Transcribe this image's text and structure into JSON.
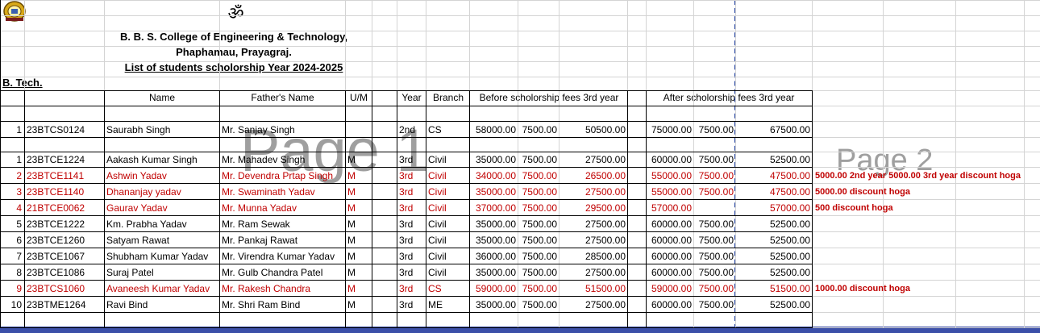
{
  "om_symbol": "ॐ",
  "college_line1": "B. B. S. College of Engineering & Technology,",
  "college_line2": "Phaphamau, Prayagraj.",
  "list_title": "List of students scholorship Year 2024-2025",
  "program": "B. Tech.",
  "headers": {
    "name": "Name",
    "father": "Father's Name",
    "um": "U/M",
    "year": "Year",
    "branch": "Branch",
    "before": "Before scholorship fees 3rd year",
    "after": "After scholorship fees 3rd year"
  },
  "watermarks": {
    "page1": "Page 1",
    "page2": "Page 2"
  },
  "first_row": {
    "sno": "1",
    "roll": "23BTCS0124",
    "name": "Saurabh Singh",
    "father": "Mr. Sanjay Singh",
    "um": "",
    "year": "2nd",
    "branch": "CS",
    "b1": "58000.00",
    "b2": "7500.00",
    "b3": "50500.00",
    "a1": "75000.00",
    "a2": "7500.00",
    "a3": "67500.00"
  },
  "rows": [
    {
      "sno": "1",
      "roll": "23BTCE1224",
      "name": "Aakash Kumar Singh",
      "father": "Mr. Mahadev Singh",
      "um": "M",
      "year": "3rd",
      "branch": "Civil",
      "b1": "35000.00",
      "b2": "7500.00",
      "b3": "27500.00",
      "a1": "60000.00",
      "a2": "7500.00",
      "a3": "52500.00",
      "note": "",
      "red": false
    },
    {
      "sno": "2",
      "roll": "23BTCE1141",
      "name": "Ashwin Yadav",
      "father": "Mr. Devendra Prtap Singh",
      "um": "M",
      "year": "3rd",
      "branch": "Civil",
      "b1": "34000.00",
      "b2": "7500.00",
      "b3": "26500.00",
      "a1": "55000.00",
      "a2": "7500.00",
      "a3": "47500.00",
      "note": "5000.00 2nd year 5000.00 3rd year discount hoga",
      "red": true
    },
    {
      "sno": "3",
      "roll": "23BTCE1140",
      "name": "Dhananjay yadav",
      "father": "Mr. Swaminath Yadav",
      "um": "M",
      "year": "3rd",
      "branch": "Civil",
      "b1": "35000.00",
      "b2": "7500.00",
      "b3": "27500.00",
      "a1": "55000.00",
      "a2": "7500.00",
      "a3": "47500.00",
      "note": "5000.00 discount hoga",
      "red": true
    },
    {
      "sno": "4",
      "roll": "21BTCE0062",
      "name": "Gaurav Yadav",
      "father": "Mr. Munna Yadav",
      "um": "M",
      "year": "3rd",
      "branch": "Civil",
      "b1": "37000.00",
      "b2": "7500.00",
      "b3": "29500.00",
      "a1": "57000.00",
      "a2": "",
      "a3": "57000.00",
      "note": "500 discount hoga",
      "red": true
    },
    {
      "sno": "5",
      "roll": "23BTCE1222",
      "name": "Km. Prabha Yadav",
      "father": "Mr. Ram Sewak",
      "um": "M",
      "year": "3rd",
      "branch": "Civil",
      "b1": "35000.00",
      "b2": "7500.00",
      "b3": "27500.00",
      "a1": "60000.00",
      "a2": "7500.00",
      "a3": "52500.00",
      "note": "",
      "red": false
    },
    {
      "sno": "6",
      "roll": "23BTCE1260",
      "name": "Satyam Rawat",
      "father": "Mr. Pankaj Rawat",
      "um": "M",
      "year": "3rd",
      "branch": "Civil",
      "b1": "35000.00",
      "b2": "7500.00",
      "b3": "27500.00",
      "a1": "60000.00",
      "a2": "7500.00",
      "a3": "52500.00",
      "note": "",
      "red": false
    },
    {
      "sno": "7",
      "roll": "23BTCE1067",
      "name": "Shubham Kumar Yadav",
      "father": "Mr. Virendra Kumar Yadav",
      "um": "M",
      "year": "3rd",
      "branch": "Civil",
      "b1": "36000.00",
      "b2": "7500.00",
      "b3": "28500.00",
      "a1": "60000.00",
      "a2": "7500.00",
      "a3": "52500.00",
      "note": "",
      "red": false
    },
    {
      "sno": "8",
      "roll": "23BTCE1086",
      "name": "Suraj Patel",
      "father": "Mr. Gulb Chandra Patel",
      "um": "M",
      "year": "3rd",
      "branch": "Civil",
      "b1": "35000.00",
      "b2": "7500.00",
      "b3": "27500.00",
      "a1": "60000.00",
      "a2": "7500.00",
      "a3": "52500.00",
      "note": "",
      "red": false
    },
    {
      "sno": "9",
      "roll": "23BTCS1060",
      "name": "Avaneesh Kumar Yadav",
      "father": "Mr. Rakesh Chandra",
      "um": "M",
      "year": "3rd",
      "branch": "CS",
      "b1": "59000.00",
      "b2": "7500.00",
      "b3": "51500.00",
      "a1": "59000.00",
      "a2": "7500.00",
      "a3": "51500.00",
      "note": "1000.00 discount hoga",
      "red": true
    },
    {
      "sno": "10",
      "roll": "23BTME1264",
      "name": "Ravi Bind",
      "father": "Mr. Shri Ram Bind",
      "um": "M",
      "year": "3rd",
      "branch": "ME",
      "b1": "35000.00",
      "b2": "7500.00",
      "b3": "27500.00",
      "a1": "60000.00",
      "a2": "7500.00",
      "a3": "52500.00",
      "note": "",
      "red": false
    }
  ],
  "colors": {
    "red_text": "#c00000",
    "page_break": "#1f3fa0",
    "watermark": "#7f7f7f"
  }
}
